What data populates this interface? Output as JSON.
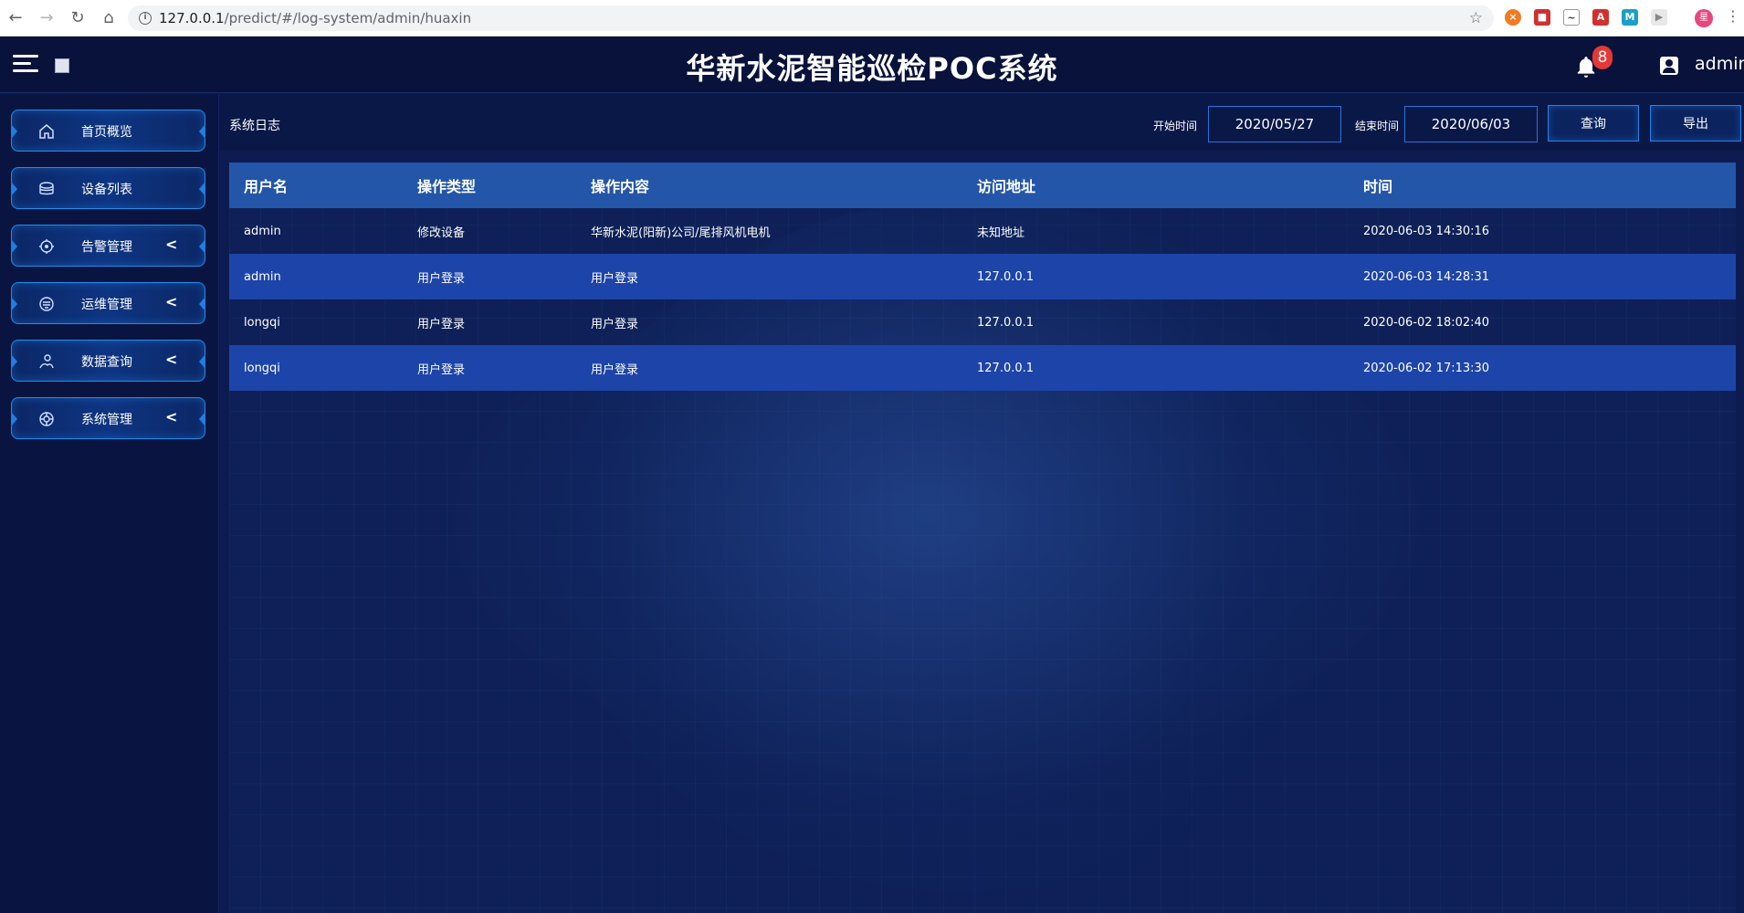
{
  "browser": {
    "url_host": "127.0.0.1",
    "url_path": "/predict/#/log-system/admin/huaxin",
    "profile_initial": "星"
  },
  "header": {
    "title": "华新水泥智能巡检POC系统",
    "notification_count": "8",
    "username": "admin"
  },
  "sidebar": {
    "items": [
      {
        "label": "首页概览",
        "icon": "home-icon",
        "has_submenu": false
      },
      {
        "label": "设备列表",
        "icon": "devices-icon",
        "has_submenu": false
      },
      {
        "label": "告警管理",
        "icon": "alarm-icon",
        "has_submenu": true
      },
      {
        "label": "运维管理",
        "icon": "maintenance-icon",
        "has_submenu": true
      },
      {
        "label": "数据查询",
        "icon": "data-query-icon",
        "has_submenu": true
      },
      {
        "label": "系统管理",
        "icon": "system-settings-icon",
        "has_submenu": true
      }
    ],
    "chevron": "<"
  },
  "toolbar": {
    "page_label": "系统日志",
    "start_label": "开始时间",
    "start_value": "2020/05/27",
    "end_label": "结束时间",
    "end_value": "2020/06/03",
    "query_button": "查询",
    "export_button": "导出"
  },
  "table": {
    "columns": [
      "用户名",
      "操作类型",
      "操作内容",
      "访问地址",
      "时间"
    ],
    "rows": [
      [
        "admin",
        "修改设备",
        "华新水泥(阳新)公司/尾排风机电机",
        "未知地址",
        "2020-06-03 14:30:16"
      ],
      [
        "admin",
        "用户登录",
        "用户登录",
        "127.0.0.1",
        "2020-06-03 14:28:31"
      ],
      [
        "longqi",
        "用户登录",
        "用户登录",
        "127.0.0.1",
        "2020-06-02 18:02:40"
      ],
      [
        "longqi",
        "用户登录",
        "用户登录",
        "127.0.0.1",
        "2020-06-02 17:13:30"
      ]
    ]
  },
  "colors": {
    "background": "#0b1847",
    "header_row": "#2356a8",
    "striped_row": "#1d44a8",
    "accent_border": "#1c8ff0",
    "badge": "#e53935"
  }
}
